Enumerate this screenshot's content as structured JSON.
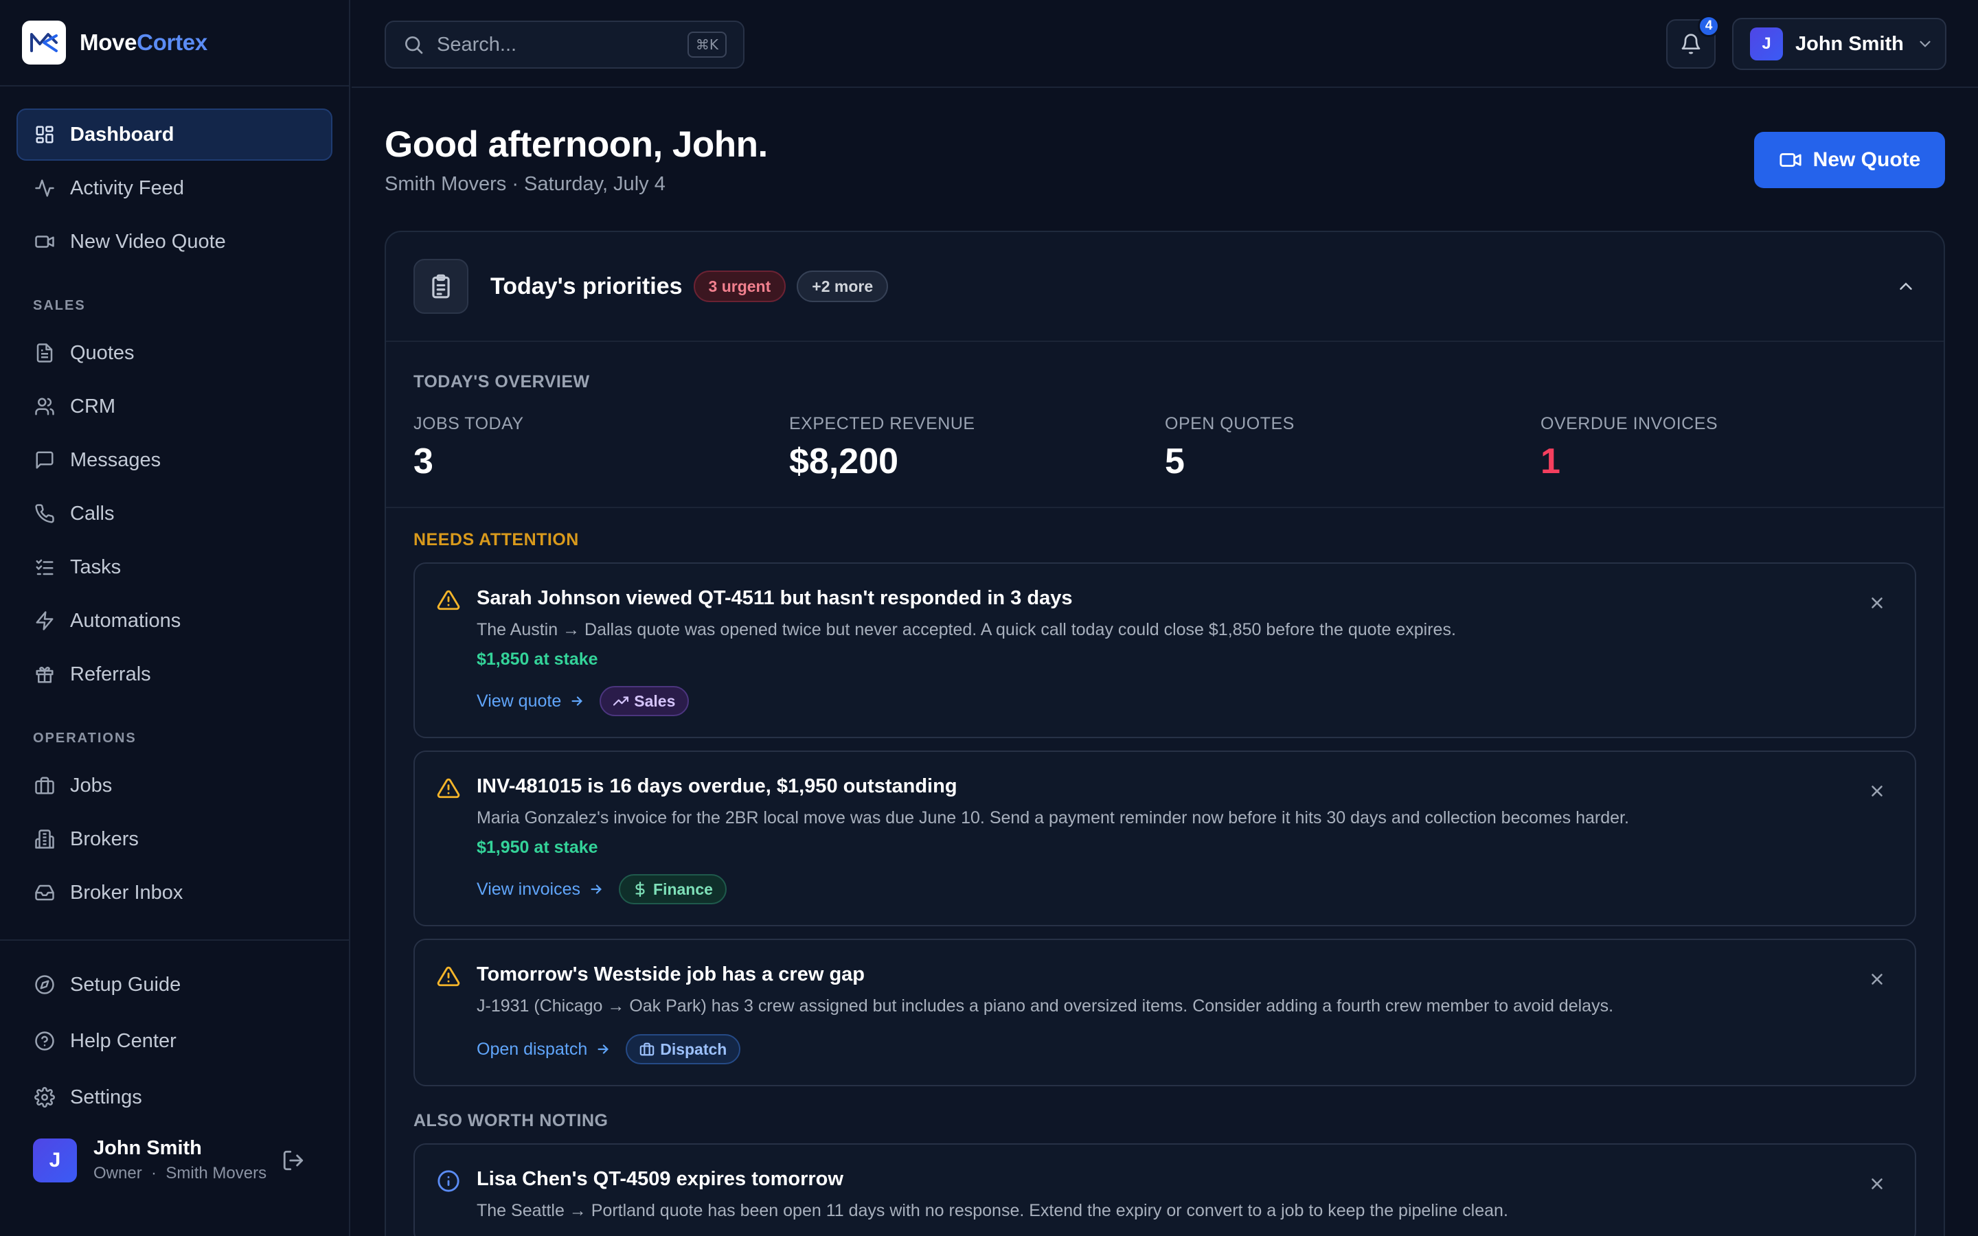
{
  "brand": {
    "name_part1": "Move",
    "name_part2": "Cortex"
  },
  "sidebar": {
    "primary": [
      {
        "label": "Dashboard",
        "icon": "dashboard-icon",
        "active": true
      },
      {
        "label": "Activity Feed",
        "icon": "activity-icon"
      },
      {
        "label": "New Video Quote",
        "icon": "video-icon"
      }
    ],
    "sales_label": "SALES",
    "sales": [
      {
        "label": "Quotes",
        "icon": "document-icon"
      },
      {
        "label": "CRM",
        "icon": "users-icon"
      },
      {
        "label": "Messages",
        "icon": "message-icon"
      },
      {
        "label": "Calls",
        "icon": "phone-icon"
      },
      {
        "label": "Tasks",
        "icon": "tasks-icon"
      },
      {
        "label": "Automations",
        "icon": "bolt-icon"
      },
      {
        "label": "Referrals",
        "icon": "gift-icon"
      }
    ],
    "operations_label": "OPERATIONS",
    "operations": [
      {
        "label": "Jobs",
        "icon": "briefcase-icon"
      },
      {
        "label": "Brokers",
        "icon": "building-icon"
      },
      {
        "label": "Broker Inbox",
        "icon": "inbox-icon"
      }
    ],
    "bottom": [
      {
        "label": "Setup Guide",
        "icon": "compass-icon"
      },
      {
        "label": "Help Center",
        "icon": "help-icon"
      },
      {
        "label": "Settings",
        "icon": "gear-icon"
      }
    ],
    "user": {
      "initial": "J",
      "name": "John Smith",
      "role": "Owner",
      "company": "Smith Movers",
      "separator": "·"
    }
  },
  "topbar": {
    "search_placeholder": "Search...",
    "search_shortcut": "⌘K",
    "notification_count": "4",
    "user_initial": "J",
    "user_name": "John Smith"
  },
  "main": {
    "greeting": "Good afternoon, John.",
    "subline": "Smith Movers · Saturday, July 4",
    "new_quote_label": "New Quote",
    "priorities": {
      "title": "Today's priorities",
      "urgent_badge": "3 urgent",
      "more_badge": "+2 more",
      "overview_title": "TODAY'S OVERVIEW",
      "stats": [
        {
          "label": "JOBS TODAY",
          "value": "3"
        },
        {
          "label": "EXPECTED REVENUE",
          "value": "$8,200"
        },
        {
          "label": "OPEN QUOTES",
          "value": "5"
        },
        {
          "label": "OVERDUE INVOICES",
          "value": "1"
        }
      ],
      "needs_attention_label": "NEEDS ATTENTION",
      "alerts": [
        {
          "title": "Sarah Johnson viewed QT-4511 but hasn't responded in 3 days",
          "description": "The Austin → Dallas quote was opened twice but never accepted. A quick call today could close $1,850 before the quote expires.",
          "stake": "$1,850 at stake",
          "action": "View quote",
          "tag": "Sales"
        },
        {
          "title": "INV-481015 is 16 days overdue, $1,950 outstanding",
          "description": "Maria Gonzalez's invoice for the 2BR local move was due June 10. Send a payment reminder now before it hits 30 days and collection becomes harder.",
          "stake": "$1,950 at stake",
          "action": "View invoices",
          "tag": "Finance"
        },
        {
          "title": "Tomorrow's Westside job has a crew gap",
          "description": "J-1931 (Chicago → Oak Park) has 3 crew assigned but includes a piano and oversized items. Consider adding a fourth crew member to avoid delays.",
          "action": "Open dispatch",
          "tag": "Dispatch"
        }
      ],
      "also_noting_label": "ALSO WORTH NOTING",
      "notes": [
        {
          "title": "Lisa Chen's QT-4509 expires tomorrow",
          "description": "The Seattle → Portland quote has been open 11 days with no response. Extend the expiry or convert to a job to keep the pipeline clean."
        }
      ]
    }
  },
  "colors": {
    "accent": "#2563eb",
    "background": "#0b1120",
    "urgent": "#f43f5e",
    "stake": "#34d399",
    "warning": "#f5b52a"
  }
}
